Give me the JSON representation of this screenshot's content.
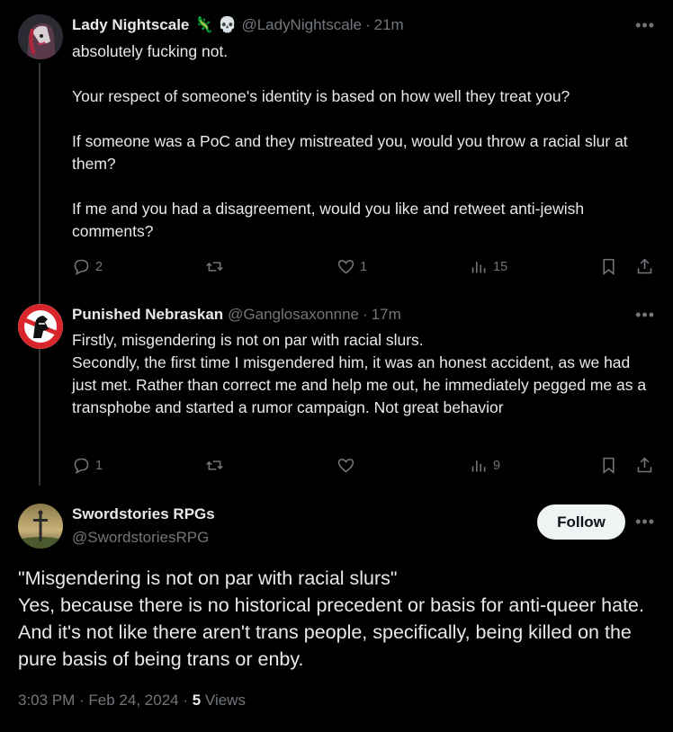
{
  "tweets": [
    {
      "name": "Lady Nightscale",
      "emoji": "🦎 💀",
      "handle": "@LadyNightscale",
      "time": "21m",
      "lines": [
        "absolutely fucking not.",
        "",
        "Your respect of someone's identity is based on how well they treat you?",
        "",
        "If someone was a PoC and they mistreated you, would you throw a racial slur at them?",
        "",
        "If me and you had a disagreement, would you like and retweet anti-jewish comments?"
      ],
      "replies": "2",
      "reposts": "",
      "likes": "1",
      "views": "15"
    },
    {
      "name": "Punished Nebraskan",
      "handle": "@Ganglosaxonnne",
      "time": "17m",
      "lines": [
        "Firstly, misgendering is not on par with racial slurs.",
        "Secondly, the first time I misgendered him, it was an honest accident, as we had just met. Rather than correct me and help me out, he immediately pegged me as a transphobe and started a rumor campaign. Not great behavior"
      ],
      "replies": "1",
      "reposts": "",
      "likes": "",
      "views": "9"
    }
  ],
  "main": {
    "name": "Swordstories RPGs",
    "handle": "@SwordstoriesRPG",
    "follow_label": "Follow",
    "lines": [
      "\"Misgendering is not on par with racial slurs\"",
      "Yes, because there is no historical precedent or basis for anti-queer hate. And it's not like there aren't trans people, specifically, being killed on the pure basis of being trans or enby."
    ],
    "timestamp": "3:03 PM · Feb 24, 2024 · ",
    "views_count": "5",
    "views_label": " Views"
  },
  "colors": {
    "bg": "#000000",
    "text": "#e7e9ea",
    "muted": "#71767b",
    "line": "#333639"
  }
}
